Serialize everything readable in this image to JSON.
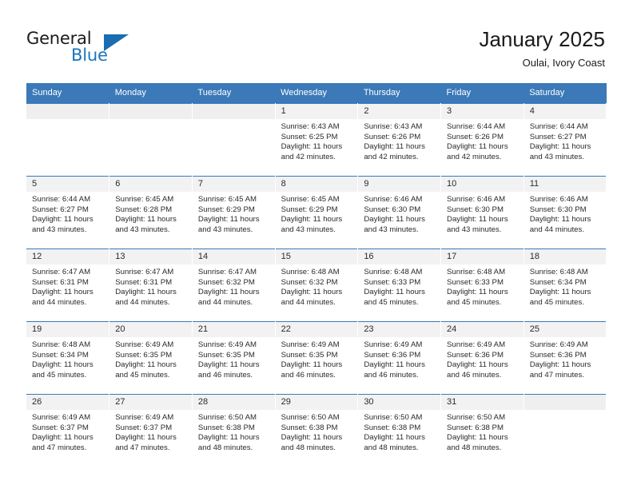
{
  "brand": {
    "word_one": "General",
    "word_two": "Blue",
    "triangle_icon": "triangle-icon",
    "accent_color": "#1b75bb"
  },
  "header": {
    "month_title": "January 2025",
    "location": "Oulai, Ivory Coast",
    "header_bg_color": "#3b79b8"
  },
  "calendar": {
    "weekday_headers": [
      "Sunday",
      "Monday",
      "Tuesday",
      "Wednesday",
      "Thursday",
      "Friday",
      "Saturday"
    ],
    "leading_blanks": 3,
    "weeks": [
      [
        {
          "blank": true
        },
        {
          "blank": true
        },
        {
          "blank": true
        },
        {
          "day": "1",
          "sunrise": "Sunrise: 6:43 AM",
          "sunset": "Sunset: 6:25 PM",
          "daylight_line1": "Daylight: 11 hours",
          "daylight_line2": "and 42 minutes."
        },
        {
          "day": "2",
          "sunrise": "Sunrise: 6:43 AM",
          "sunset": "Sunset: 6:26 PM",
          "daylight_line1": "Daylight: 11 hours",
          "daylight_line2": "and 42 minutes."
        },
        {
          "day": "3",
          "sunrise": "Sunrise: 6:44 AM",
          "sunset": "Sunset: 6:26 PM",
          "daylight_line1": "Daylight: 11 hours",
          "daylight_line2": "and 42 minutes."
        },
        {
          "day": "4",
          "sunrise": "Sunrise: 6:44 AM",
          "sunset": "Sunset: 6:27 PM",
          "daylight_line1": "Daylight: 11 hours",
          "daylight_line2": "and 43 minutes."
        }
      ],
      [
        {
          "day": "5",
          "sunrise": "Sunrise: 6:44 AM",
          "sunset": "Sunset: 6:27 PM",
          "daylight_line1": "Daylight: 11 hours",
          "daylight_line2": "and 43 minutes."
        },
        {
          "day": "6",
          "sunrise": "Sunrise: 6:45 AM",
          "sunset": "Sunset: 6:28 PM",
          "daylight_line1": "Daylight: 11 hours",
          "daylight_line2": "and 43 minutes."
        },
        {
          "day": "7",
          "sunrise": "Sunrise: 6:45 AM",
          "sunset": "Sunset: 6:29 PM",
          "daylight_line1": "Daylight: 11 hours",
          "daylight_line2": "and 43 minutes."
        },
        {
          "day": "8",
          "sunrise": "Sunrise: 6:45 AM",
          "sunset": "Sunset: 6:29 PM",
          "daylight_line1": "Daylight: 11 hours",
          "daylight_line2": "and 43 minutes."
        },
        {
          "day": "9",
          "sunrise": "Sunrise: 6:46 AM",
          "sunset": "Sunset: 6:30 PM",
          "daylight_line1": "Daylight: 11 hours",
          "daylight_line2": "and 43 minutes."
        },
        {
          "day": "10",
          "sunrise": "Sunrise: 6:46 AM",
          "sunset": "Sunset: 6:30 PM",
          "daylight_line1": "Daylight: 11 hours",
          "daylight_line2": "and 43 minutes."
        },
        {
          "day": "11",
          "sunrise": "Sunrise: 6:46 AM",
          "sunset": "Sunset: 6:30 PM",
          "daylight_line1": "Daylight: 11 hours",
          "daylight_line2": "and 44 minutes."
        }
      ],
      [
        {
          "day": "12",
          "sunrise": "Sunrise: 6:47 AM",
          "sunset": "Sunset: 6:31 PM",
          "daylight_line1": "Daylight: 11 hours",
          "daylight_line2": "and 44 minutes."
        },
        {
          "day": "13",
          "sunrise": "Sunrise: 6:47 AM",
          "sunset": "Sunset: 6:31 PM",
          "daylight_line1": "Daylight: 11 hours",
          "daylight_line2": "and 44 minutes."
        },
        {
          "day": "14",
          "sunrise": "Sunrise: 6:47 AM",
          "sunset": "Sunset: 6:32 PM",
          "daylight_line1": "Daylight: 11 hours",
          "daylight_line2": "and 44 minutes."
        },
        {
          "day": "15",
          "sunrise": "Sunrise: 6:48 AM",
          "sunset": "Sunset: 6:32 PM",
          "daylight_line1": "Daylight: 11 hours",
          "daylight_line2": "and 44 minutes."
        },
        {
          "day": "16",
          "sunrise": "Sunrise: 6:48 AM",
          "sunset": "Sunset: 6:33 PM",
          "daylight_line1": "Daylight: 11 hours",
          "daylight_line2": "and 45 minutes."
        },
        {
          "day": "17",
          "sunrise": "Sunrise: 6:48 AM",
          "sunset": "Sunset: 6:33 PM",
          "daylight_line1": "Daylight: 11 hours",
          "daylight_line2": "and 45 minutes."
        },
        {
          "day": "18",
          "sunrise": "Sunrise: 6:48 AM",
          "sunset": "Sunset: 6:34 PM",
          "daylight_line1": "Daylight: 11 hours",
          "daylight_line2": "and 45 minutes."
        }
      ],
      [
        {
          "day": "19",
          "sunrise": "Sunrise: 6:48 AM",
          "sunset": "Sunset: 6:34 PM",
          "daylight_line1": "Daylight: 11 hours",
          "daylight_line2": "and 45 minutes."
        },
        {
          "day": "20",
          "sunrise": "Sunrise: 6:49 AM",
          "sunset": "Sunset: 6:35 PM",
          "daylight_line1": "Daylight: 11 hours",
          "daylight_line2": "and 45 minutes."
        },
        {
          "day": "21",
          "sunrise": "Sunrise: 6:49 AM",
          "sunset": "Sunset: 6:35 PM",
          "daylight_line1": "Daylight: 11 hours",
          "daylight_line2": "and 46 minutes."
        },
        {
          "day": "22",
          "sunrise": "Sunrise: 6:49 AM",
          "sunset": "Sunset: 6:35 PM",
          "daylight_line1": "Daylight: 11 hours",
          "daylight_line2": "and 46 minutes."
        },
        {
          "day": "23",
          "sunrise": "Sunrise: 6:49 AM",
          "sunset": "Sunset: 6:36 PM",
          "daylight_line1": "Daylight: 11 hours",
          "daylight_line2": "and 46 minutes."
        },
        {
          "day": "24",
          "sunrise": "Sunrise: 6:49 AM",
          "sunset": "Sunset: 6:36 PM",
          "daylight_line1": "Daylight: 11 hours",
          "daylight_line2": "and 46 minutes."
        },
        {
          "day": "25",
          "sunrise": "Sunrise: 6:49 AM",
          "sunset": "Sunset: 6:36 PM",
          "daylight_line1": "Daylight: 11 hours",
          "daylight_line2": "and 47 minutes."
        }
      ],
      [
        {
          "day": "26",
          "sunrise": "Sunrise: 6:49 AM",
          "sunset": "Sunset: 6:37 PM",
          "daylight_line1": "Daylight: 11 hours",
          "daylight_line2": "and 47 minutes."
        },
        {
          "day": "27",
          "sunrise": "Sunrise: 6:49 AM",
          "sunset": "Sunset: 6:37 PM",
          "daylight_line1": "Daylight: 11 hours",
          "daylight_line2": "and 47 minutes."
        },
        {
          "day": "28",
          "sunrise": "Sunrise: 6:50 AM",
          "sunset": "Sunset: 6:38 PM",
          "daylight_line1": "Daylight: 11 hours",
          "daylight_line2": "and 48 minutes."
        },
        {
          "day": "29",
          "sunrise": "Sunrise: 6:50 AM",
          "sunset": "Sunset: 6:38 PM",
          "daylight_line1": "Daylight: 11 hours",
          "daylight_line2": "and 48 minutes."
        },
        {
          "day": "30",
          "sunrise": "Sunrise: 6:50 AM",
          "sunset": "Sunset: 6:38 PM",
          "daylight_line1": "Daylight: 11 hours",
          "daylight_line2": "and 48 minutes."
        },
        {
          "day": "31",
          "sunrise": "Sunrise: 6:50 AM",
          "sunset": "Sunset: 6:38 PM",
          "daylight_line1": "Daylight: 11 hours",
          "daylight_line2": "and 48 minutes."
        },
        {
          "blank": true
        }
      ]
    ]
  }
}
